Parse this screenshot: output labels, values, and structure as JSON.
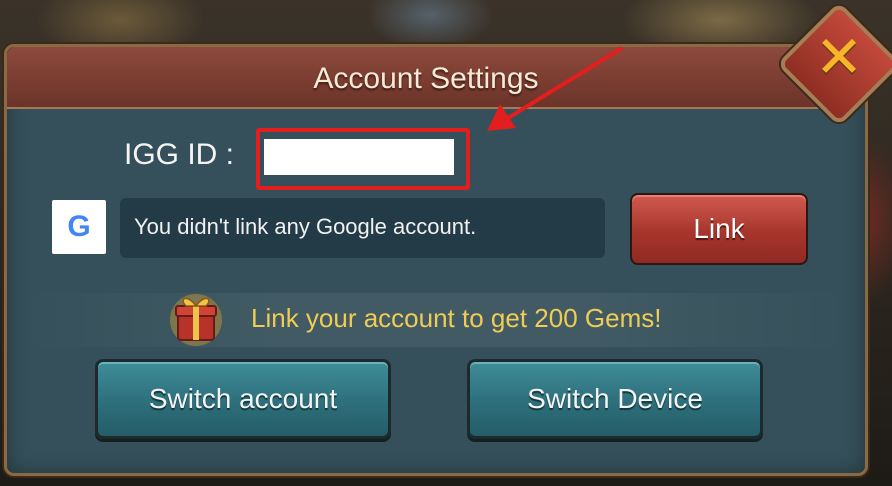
{
  "dialog": {
    "title": "Account Settings",
    "close_icon": "close-x-icon"
  },
  "igg": {
    "label": "IGG ID :",
    "value": ""
  },
  "google": {
    "icon_letter": "G",
    "status": "You didn't link any Google account.",
    "link_label": "Link"
  },
  "promo": {
    "icon": "gift-box-icon",
    "text": "Link your account to get 200 Gems!"
  },
  "buttons": {
    "switch_account": "Switch account",
    "switch_device": "Switch Device"
  },
  "colors": {
    "panel": "#35505a",
    "header": "#7a3c31",
    "link_button": "#a8352d",
    "teal_button": "#2d6f7b",
    "promo_text": "#f0cc55",
    "annotation": "#e21e1e"
  }
}
